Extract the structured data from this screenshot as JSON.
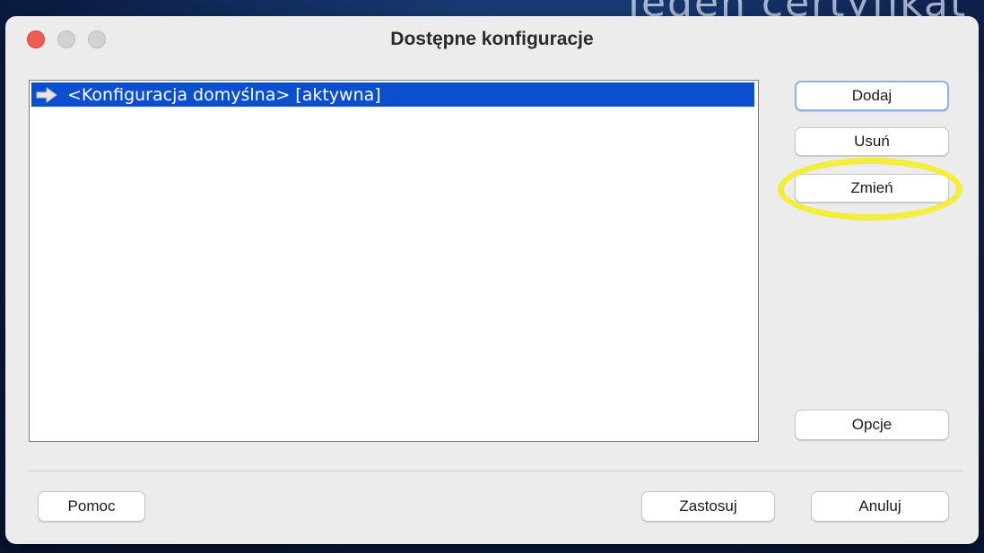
{
  "background": {
    "text": "Jeden certyfikat"
  },
  "window": {
    "title": "Dostępne konfiguracje",
    "colors": {
      "close": "#ee5b53",
      "selection": "#0a4fd0",
      "highlight": "#f2ee3a"
    }
  },
  "list": {
    "items": [
      {
        "icon": "arrow-right-icon",
        "label": "<Konfiguracja domyślna> [aktywna]",
        "selected": true
      }
    ]
  },
  "side_buttons": {
    "add": "Dodaj",
    "remove": "Usuń",
    "change": "Zmień",
    "options": "Opcje"
  },
  "footer": {
    "help": "Pomoc",
    "apply": "Zastosuj",
    "cancel": "Anuluj"
  }
}
